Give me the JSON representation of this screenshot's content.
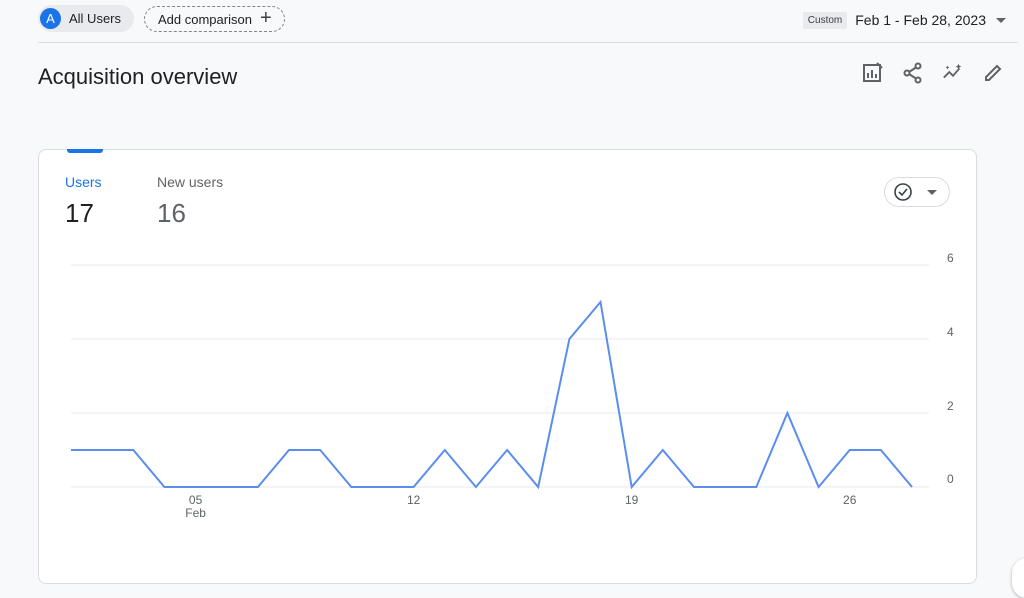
{
  "header": {
    "avatar_letter": "A",
    "segment_label": "All Users",
    "add_comparison_label": "Add comparison",
    "date_tag": "Custom",
    "date_range": "Feb 1 - Feb 28, 2023"
  },
  "page": {
    "title": "Acquisition overview",
    "toolbar_icons": [
      "customize-report-icon",
      "share-icon",
      "insights-icon",
      "edit-icon"
    ]
  },
  "card": {
    "metrics": [
      {
        "label": "Users",
        "value": "17",
        "selected": true
      },
      {
        "label": "New users",
        "value": "16",
        "selected": false
      }
    ],
    "compare_icon": "check-circle-icon"
  },
  "colors": {
    "accent": "#1a73e8",
    "line": "#5b8def",
    "grid": "#e8eaed"
  },
  "chart_data": {
    "type": "line",
    "x": [
      "Feb 1",
      "Feb 2",
      "Feb 3",
      "Feb 4",
      "Feb 5",
      "Feb 6",
      "Feb 7",
      "Feb 8",
      "Feb 9",
      "Feb 10",
      "Feb 11",
      "Feb 12",
      "Feb 13",
      "Feb 14",
      "Feb 15",
      "Feb 16",
      "Feb 17",
      "Feb 18",
      "Feb 19",
      "Feb 20",
      "Feb 21",
      "Feb 22",
      "Feb 23",
      "Feb 24",
      "Feb 25",
      "Feb 26",
      "Feb 27",
      "Feb 28"
    ],
    "series": [
      {
        "values": [
          1,
          1,
          1,
          0,
          0,
          0,
          0,
          1,
          1,
          0,
          0,
          0,
          1,
          0,
          1,
          0,
          4,
          5,
          0,
          1,
          0,
          0,
          0,
          2,
          0,
          1,
          1,
          0
        ]
      }
    ],
    "x_ticks": [
      {
        "index": 4,
        "label": "05",
        "sublabel": "Feb"
      },
      {
        "index": 11,
        "label": "12",
        "sublabel": ""
      },
      {
        "index": 18,
        "label": "19",
        "sublabel": ""
      },
      {
        "index": 25,
        "label": "26",
        "sublabel": ""
      }
    ],
    "y_ticks": [
      0,
      2,
      4,
      6
    ],
    "ylim": [
      0,
      6
    ],
    "grid": true,
    "y_axis_position": "right"
  }
}
